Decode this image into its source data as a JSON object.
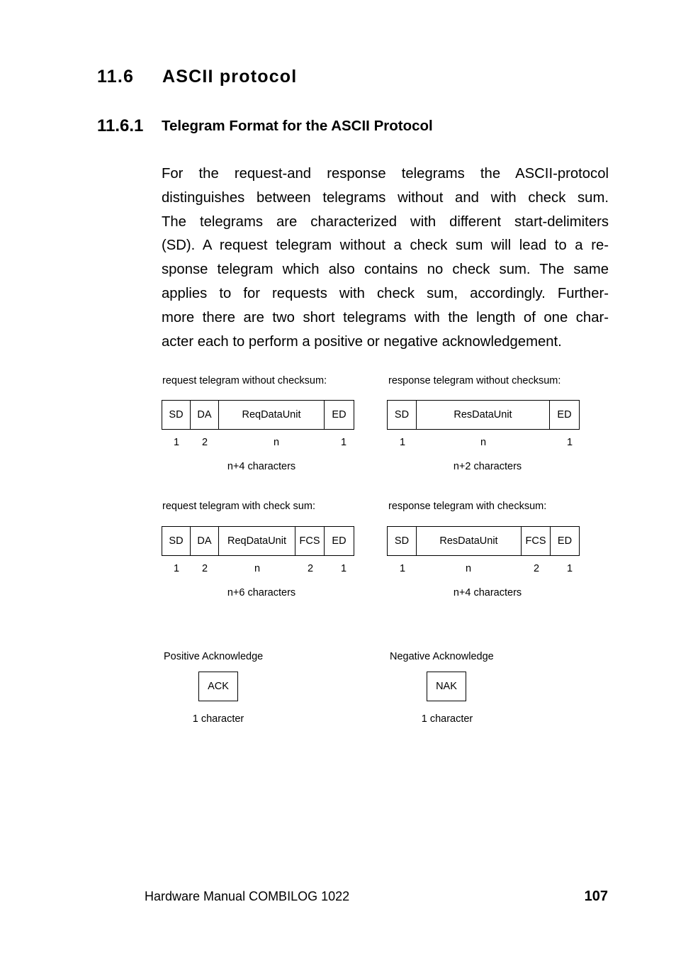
{
  "section": {
    "number": "11.6",
    "title": "ASCII protocol"
  },
  "subsection": {
    "number": "11.6.1",
    "title": "Telegram Format for the ASCII Protocol"
  },
  "paragraph_lines": [
    "For the request-and response telegrams the ASCII-protocol",
    "distinguishes between telegrams without and with check sum.",
    "The telegrams are characterized with different start-delimiters",
    "(SD). A request telegram without a check sum will lead to a re-",
    "sponse telegram which also contains no check sum. The same",
    "applies to for requests with check sum, accordingly. Further-",
    "more there are two short telegrams with the length of one char-",
    "acter each to perform a positive or negative acknowledgement."
  ],
  "diagrams": {
    "req_no_cs": {
      "caption": "request telegram without checksum:",
      "fields": [
        "SD",
        "DA",
        "ReqDataUnit",
        "ED"
      ],
      "lengths": [
        "1",
        "2",
        "n",
        "1"
      ],
      "total": "n+4 characters"
    },
    "res_no_cs": {
      "caption": "response telegram without checksum:",
      "fields": [
        "SD",
        "ResDataUnit",
        "ED"
      ],
      "lengths": [
        "1",
        "n",
        "1"
      ],
      "total": "n+2 characters"
    },
    "req_cs": {
      "caption": "request telegram with check sum:",
      "fields": [
        "SD",
        "DA",
        "ReqDataUnit",
        "FCS",
        "ED"
      ],
      "lengths": [
        "1",
        "2",
        "n",
        "2",
        "1"
      ],
      "total": "n+6 characters"
    },
    "res_cs": {
      "caption": "response telegram with checksum:",
      "fields": [
        "SD",
        "ResDataUnit",
        "FCS",
        "ED"
      ],
      "lengths": [
        "1",
        "n",
        "2",
        "1"
      ],
      "total": "n+4 characters"
    },
    "ack": {
      "caption": "Positive Acknowledge",
      "field": "ACK",
      "total": "1 character"
    },
    "nak": {
      "caption": "Negative Acknowledge",
      "field": "NAK",
      "total": "1 character"
    }
  },
  "footer": {
    "manual_title": "Hardware Manual COMBILOG 1022",
    "page_number": "107"
  }
}
